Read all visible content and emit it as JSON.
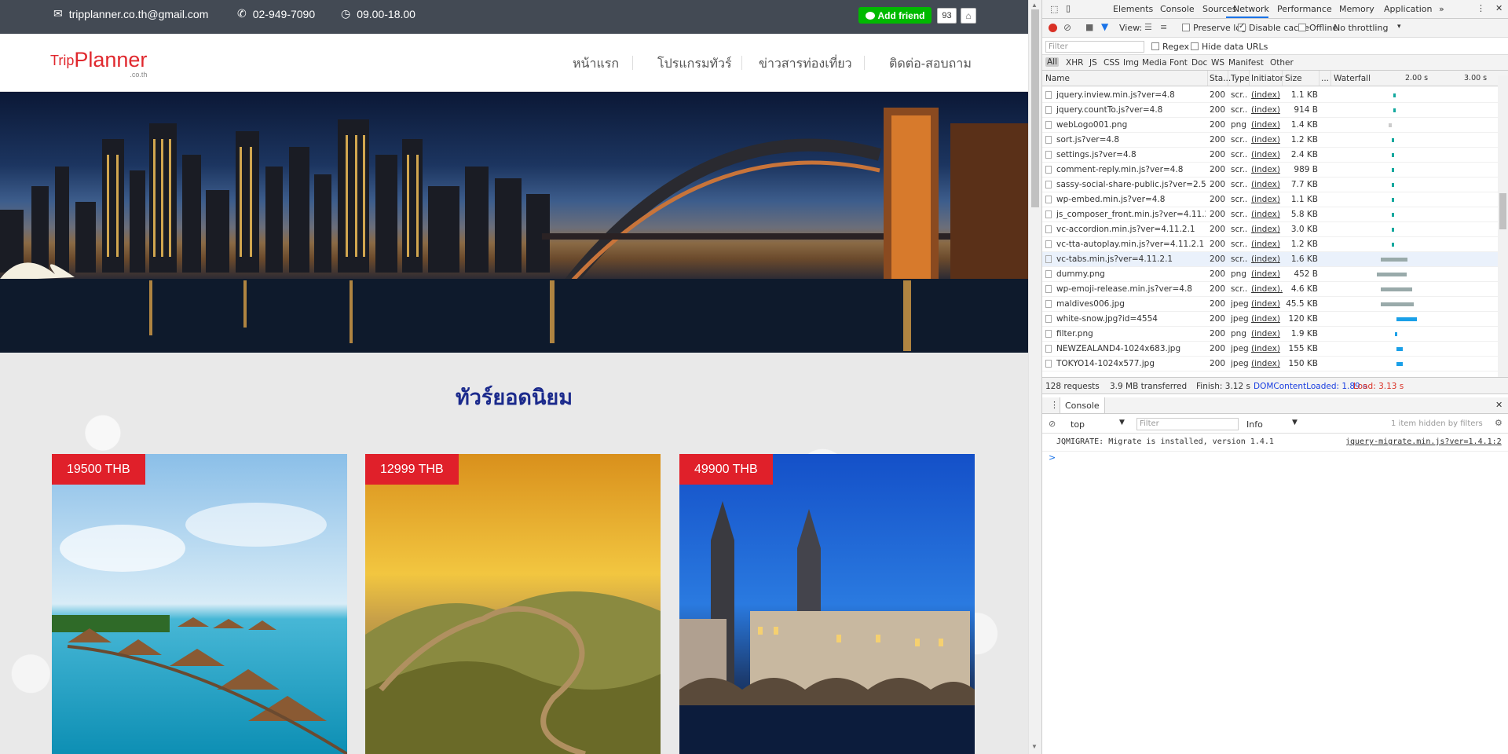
{
  "site": {
    "topbar": {
      "email": "tripplanner.co.th@gmail.com",
      "phone": "02-949-7090",
      "hours": "09.00-18.00",
      "add_friend": "Add friend",
      "friend_count": "93",
      "email_icon": "envelope-icon",
      "phone_icon": "phone-icon",
      "clock_icon": "clock-icon",
      "line_icon": "line-chat-icon",
      "home_icon": "home-icon"
    },
    "logo": {
      "trip": "Trip",
      "planner": "Planner",
      "domain": ".co.th"
    },
    "menu": [
      "หน้าแรก",
      "โปรแกรมทัวร์",
      "ข่าวสารท่องเที่ยว",
      "ติดต่อ-สอบถาม"
    ],
    "section_title": "ทัวร์ยอดนิยม",
    "cards": [
      {
        "price": "19500 THB"
      },
      {
        "price": "12999 THB"
      },
      {
        "price": "49900 THB"
      }
    ],
    "colors": {
      "topbar": "#434a54",
      "accent_red": "#e0202a",
      "title_blue": "#1b2a8c",
      "line_green": "#00b900"
    }
  },
  "devtools": {
    "tabs": [
      "Elements",
      "Console",
      "Sources",
      "Network",
      "Performance",
      "Memory",
      "Application",
      "»"
    ],
    "active_tab": "Network",
    "toolbar": {
      "view_label": "View:",
      "preserve_log": "Preserve log",
      "disable_cache": "Disable cache",
      "offline": "Offline",
      "throttling": "No throttling"
    },
    "filter": {
      "placeholder": "Filter",
      "regex": "Regex",
      "hide_data_urls": "Hide data URLs"
    },
    "types": [
      "All",
      "XHR",
      "JS",
      "CSS",
      "Img",
      "Media",
      "Font",
      "Doc",
      "WS",
      "Manifest",
      "Other"
    ],
    "columns": {
      "name": "Name",
      "status": "Sta...",
      "type": "Type",
      "initiator": "Initiator",
      "size": "Size",
      "more": "...",
      "waterfall": "Waterfall",
      "tick1": "2.00 s",
      "tick2": "3.00 s"
    },
    "requests": [
      {
        "name": "jquery.inview.min.js?ver=4.8",
        "status": "200",
        "type": "scr...",
        "initiator": "(index)",
        "size": "1.1 KB"
      },
      {
        "name": "jquery.countTo.js?ver=4.8",
        "status": "200",
        "type": "scr...",
        "initiator": "(index)",
        "size": "914 B"
      },
      {
        "name": "webLogo001.png",
        "status": "200",
        "type": "png",
        "initiator": "(index)",
        "size": "1.4 KB"
      },
      {
        "name": "sort.js?ver=4.8",
        "status": "200",
        "type": "scr...",
        "initiator": "(index)",
        "size": "1.2 KB"
      },
      {
        "name": "settings.js?ver=4.8",
        "status": "200",
        "type": "scr...",
        "initiator": "(index)",
        "size": "2.4 KB"
      },
      {
        "name": "comment-reply.min.js?ver=4.8",
        "status": "200",
        "type": "scr...",
        "initiator": "(index)",
        "size": "989 B"
      },
      {
        "name": "sassy-social-share-public.js?ver=2.5.8",
        "status": "200",
        "type": "scr...",
        "initiator": "(index)",
        "size": "7.7 KB"
      },
      {
        "name": "wp-embed.min.js?ver=4.8",
        "status": "200",
        "type": "scr...",
        "initiator": "(index)",
        "size": "1.1 KB"
      },
      {
        "name": "js_composer_front.min.js?ver=4.11.2.1",
        "status": "200",
        "type": "scr...",
        "initiator": "(index)",
        "size": "5.8 KB"
      },
      {
        "name": "vc-accordion.min.js?ver=4.11.2.1",
        "status": "200",
        "type": "scr...",
        "initiator": "(index)",
        "size": "3.0 KB"
      },
      {
        "name": "vc-tta-autoplay.min.js?ver=4.11.2.1",
        "status": "200",
        "type": "scr...",
        "initiator": "(index)",
        "size": "1.2 KB"
      },
      {
        "name": "vc-tabs.min.js?ver=4.11.2.1",
        "status": "200",
        "type": "scr...",
        "initiator": "(index)",
        "size": "1.6 KB"
      },
      {
        "name": "dummy.png",
        "status": "200",
        "type": "png",
        "initiator": "(index)",
        "size": "452 B"
      },
      {
        "name": "wp-emoji-release.min.js?ver=4.8",
        "status": "200",
        "type": "scr...",
        "initiator": "(index)...",
        "size": "4.6 KB"
      },
      {
        "name": "maldives006.jpg",
        "status": "200",
        "type": "jpeg",
        "initiator": "(index)",
        "size": "45.5 KB"
      },
      {
        "name": "white-snow.jpg?id=4554",
        "status": "200",
        "type": "jpeg",
        "initiator": "(index)",
        "size": "120 KB"
      },
      {
        "name": "filter.png",
        "status": "200",
        "type": "png",
        "initiator": "(index)",
        "size": "1.9 KB"
      },
      {
        "name": "NEWZEALAND4-1024x683.jpg",
        "status": "200",
        "type": "jpeg",
        "initiator": "(index)",
        "size": "155 KB"
      },
      {
        "name": "TOKYO14-1024x577.jpg",
        "status": "200",
        "type": "jpeg",
        "initiator": "(index)",
        "size": "150 KB"
      }
    ],
    "summary": {
      "requests": "128 requests",
      "transferred": "3.9 MB transferred",
      "finish": "Finish: 3.12 s",
      "dcl": "DOMContentLoaded: 1.89 s",
      "load": "Load: 3.13 s"
    },
    "console": {
      "tab": "Console",
      "context": "top",
      "filter_placeholder": "Filter",
      "level": "Info",
      "hidden": "1 item hidden by filters",
      "message": "JQMIGRATE: Migrate is installed, version 1.4.1",
      "source": "jquery-migrate.min.js?ver=1.4.1:2",
      "prompt": ">"
    }
  }
}
